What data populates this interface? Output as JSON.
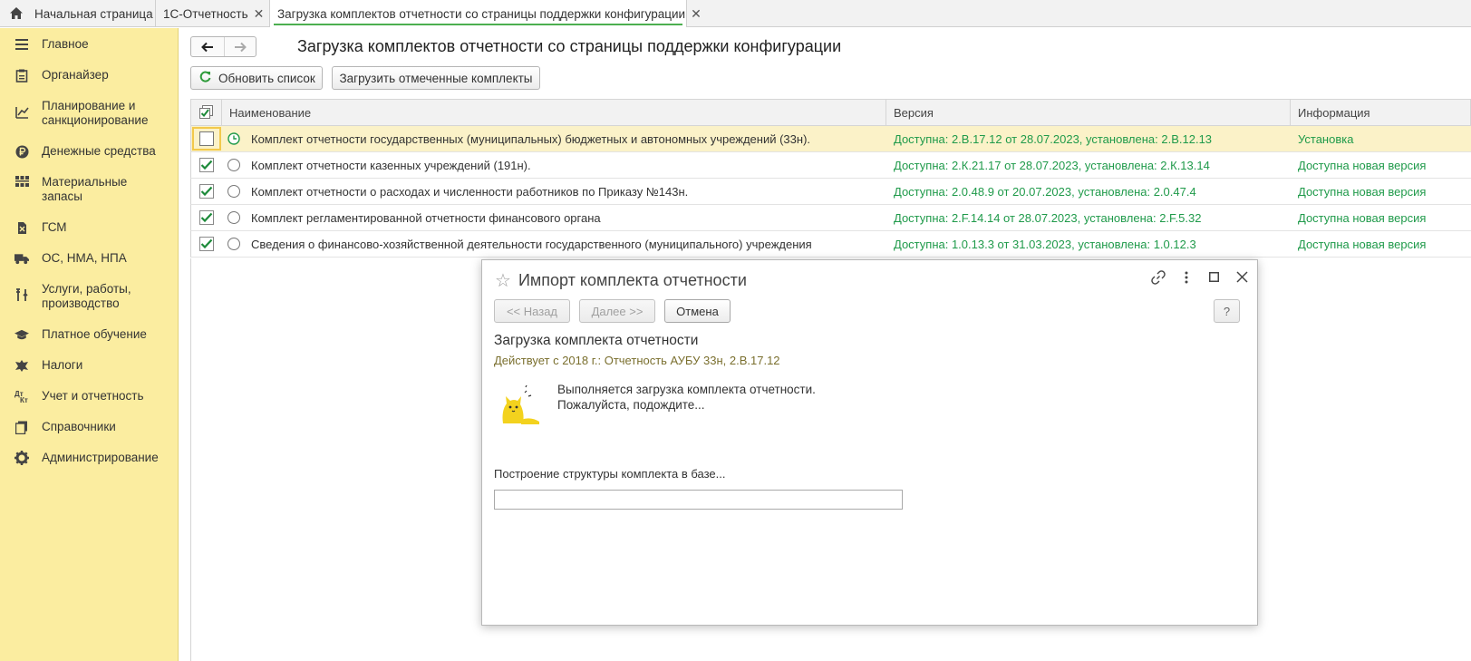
{
  "tabs": {
    "home": "Начальная страница",
    "t2": "1С-Отчетность",
    "t3": "Загрузка комплектов отчетности со страницы поддержки конфигурации"
  },
  "sidebar": {
    "items": [
      {
        "label": "Главное",
        "icon": "menu-icon"
      },
      {
        "label": "Органайзер",
        "icon": "clipboard-icon"
      },
      {
        "label": "Планирование и санкционирование",
        "icon": "planning-icon"
      },
      {
        "label": "Денежные средства",
        "icon": "ruble-icon"
      },
      {
        "label": "Материальные запасы",
        "icon": "inventory-icon"
      },
      {
        "label": "ГСМ",
        "icon": "fuel-icon"
      },
      {
        "label": "ОС, НМА, НПА",
        "icon": "truck-icon"
      },
      {
        "label": "Услуги, работы, производство",
        "icon": "tools-icon"
      },
      {
        "label": "Платное обучение",
        "icon": "graduation-cap-icon"
      },
      {
        "label": "Налоги",
        "icon": "emblem-icon"
      },
      {
        "label": "Учет и отчетность",
        "icon": "debit-credit-icon"
      },
      {
        "label": "Справочники",
        "icon": "books-icon"
      },
      {
        "label": "Администрирование",
        "icon": "gear-icon"
      }
    ]
  },
  "main": {
    "title": "Загрузка комплектов отчетности со страницы поддержки конфигурации",
    "refresh_label": "Обновить список",
    "load_marked_label": "Загрузить отмеченные комплекты"
  },
  "table": {
    "headers": [
      "Наименование",
      "Версия",
      "Информация"
    ],
    "rows": [
      {
        "checked": false,
        "selected": true,
        "status_icon": "clock-icon",
        "name": "Комплект отчетности государственных (муниципальных) бюджетных и автономных учреждений (33н).",
        "version": "Доступна: 2.В.17.12 от 28.07.2023, установлена: 2.В.12.13",
        "info": "Установка"
      },
      {
        "checked": true,
        "selected": false,
        "status_icon": "radio-icon",
        "name": "Комплект отчетности казенных учреждений (191н).",
        "version": "Доступна: 2.К.21.17 от 28.07.2023, установлена: 2.К.13.14",
        "info": "Доступна новая версия"
      },
      {
        "checked": true,
        "selected": false,
        "status_icon": "radio-icon",
        "name": "Комплект отчетности о расходах и численности работников по Приказу №143н.",
        "version": "Доступна: 2.0.48.9 от 20.07.2023, установлена: 2.0.47.4",
        "info": "Доступна новая версия"
      },
      {
        "checked": true,
        "selected": false,
        "status_icon": "radio-icon",
        "name": "Комплект регламентированной отчетности финансового органа",
        "version": "Доступна: 2.F.14.14 от 28.07.2023, установлена: 2.F.5.32",
        "info": "Доступна новая версия"
      },
      {
        "checked": true,
        "selected": false,
        "status_icon": "radio-icon",
        "name": "Сведения о финансово-хозяйственной деятельности государственного (муниципального) учреждения",
        "version": "Доступна: 1.0.13.3 от 31.03.2023, установлена: 1.0.12.3",
        "info": "Доступна новая версия"
      }
    ]
  },
  "dialog": {
    "title": "Импорт комплекта отчетности",
    "back_label": "<< Назад",
    "next_label": "Далее >>",
    "cancel_label": "Отмена",
    "help_label": "?",
    "heading": "Загрузка комплекта отчетности",
    "subtitle": "Действует с 2018 г.: Отчетность АУБУ 33н, 2.В.17.12",
    "message_line1": "Выполняется загрузка комплекта отчетности.",
    "message_line2": "Пожалуйста, подождите...",
    "status": "Построение структуры комплекта в базе...",
    "progress": 0
  },
  "colors": {
    "sidebar_bg": "#fbeda0",
    "accent_green": "#1f9a4a",
    "selected_row": "#fbf2c8"
  }
}
